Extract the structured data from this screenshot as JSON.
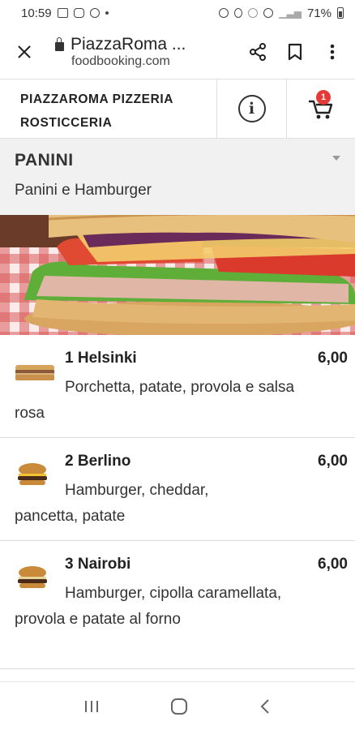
{
  "status_bar": {
    "time": "10:59",
    "battery": "71%"
  },
  "browser": {
    "page_title": "PiazzaRoma ...",
    "domain": "foodbooking.com"
  },
  "restaurant": {
    "name_line1": "PIAZZAROMA PIZZERIA",
    "name_line2": "ROSTICCERIA",
    "cart_count": "1"
  },
  "category": {
    "title": "PANINI",
    "subtitle": "Panini e Hamburger"
  },
  "menu_items": [
    {
      "name": "1 Helsinki",
      "price": "6,00",
      "description": "Porchetta, patate, provola e salsa rosa",
      "thumb": "panino"
    },
    {
      "name": "2 Berlino",
      "price": "6,00",
      "description": "Hamburger, cheddar, pancetta, patate",
      "thumb": "burger"
    },
    {
      "name": "3 Nairobi",
      "price": "6,00",
      "description": "Hamburger, cipolla caramellata, provola e patate al forno",
      "thumb": "burger"
    }
  ],
  "icons": {
    "close": "close-icon",
    "lock": "lock-icon",
    "share": "share-icon",
    "bookmark": "bookmark-icon",
    "more": "more-vert-icon",
    "info": "info-icon",
    "cart": "cart-icon",
    "caret": "chevron-down-icon"
  },
  "colors": {
    "badge": "#e53935",
    "category_bg": "#f1f1f1"
  }
}
